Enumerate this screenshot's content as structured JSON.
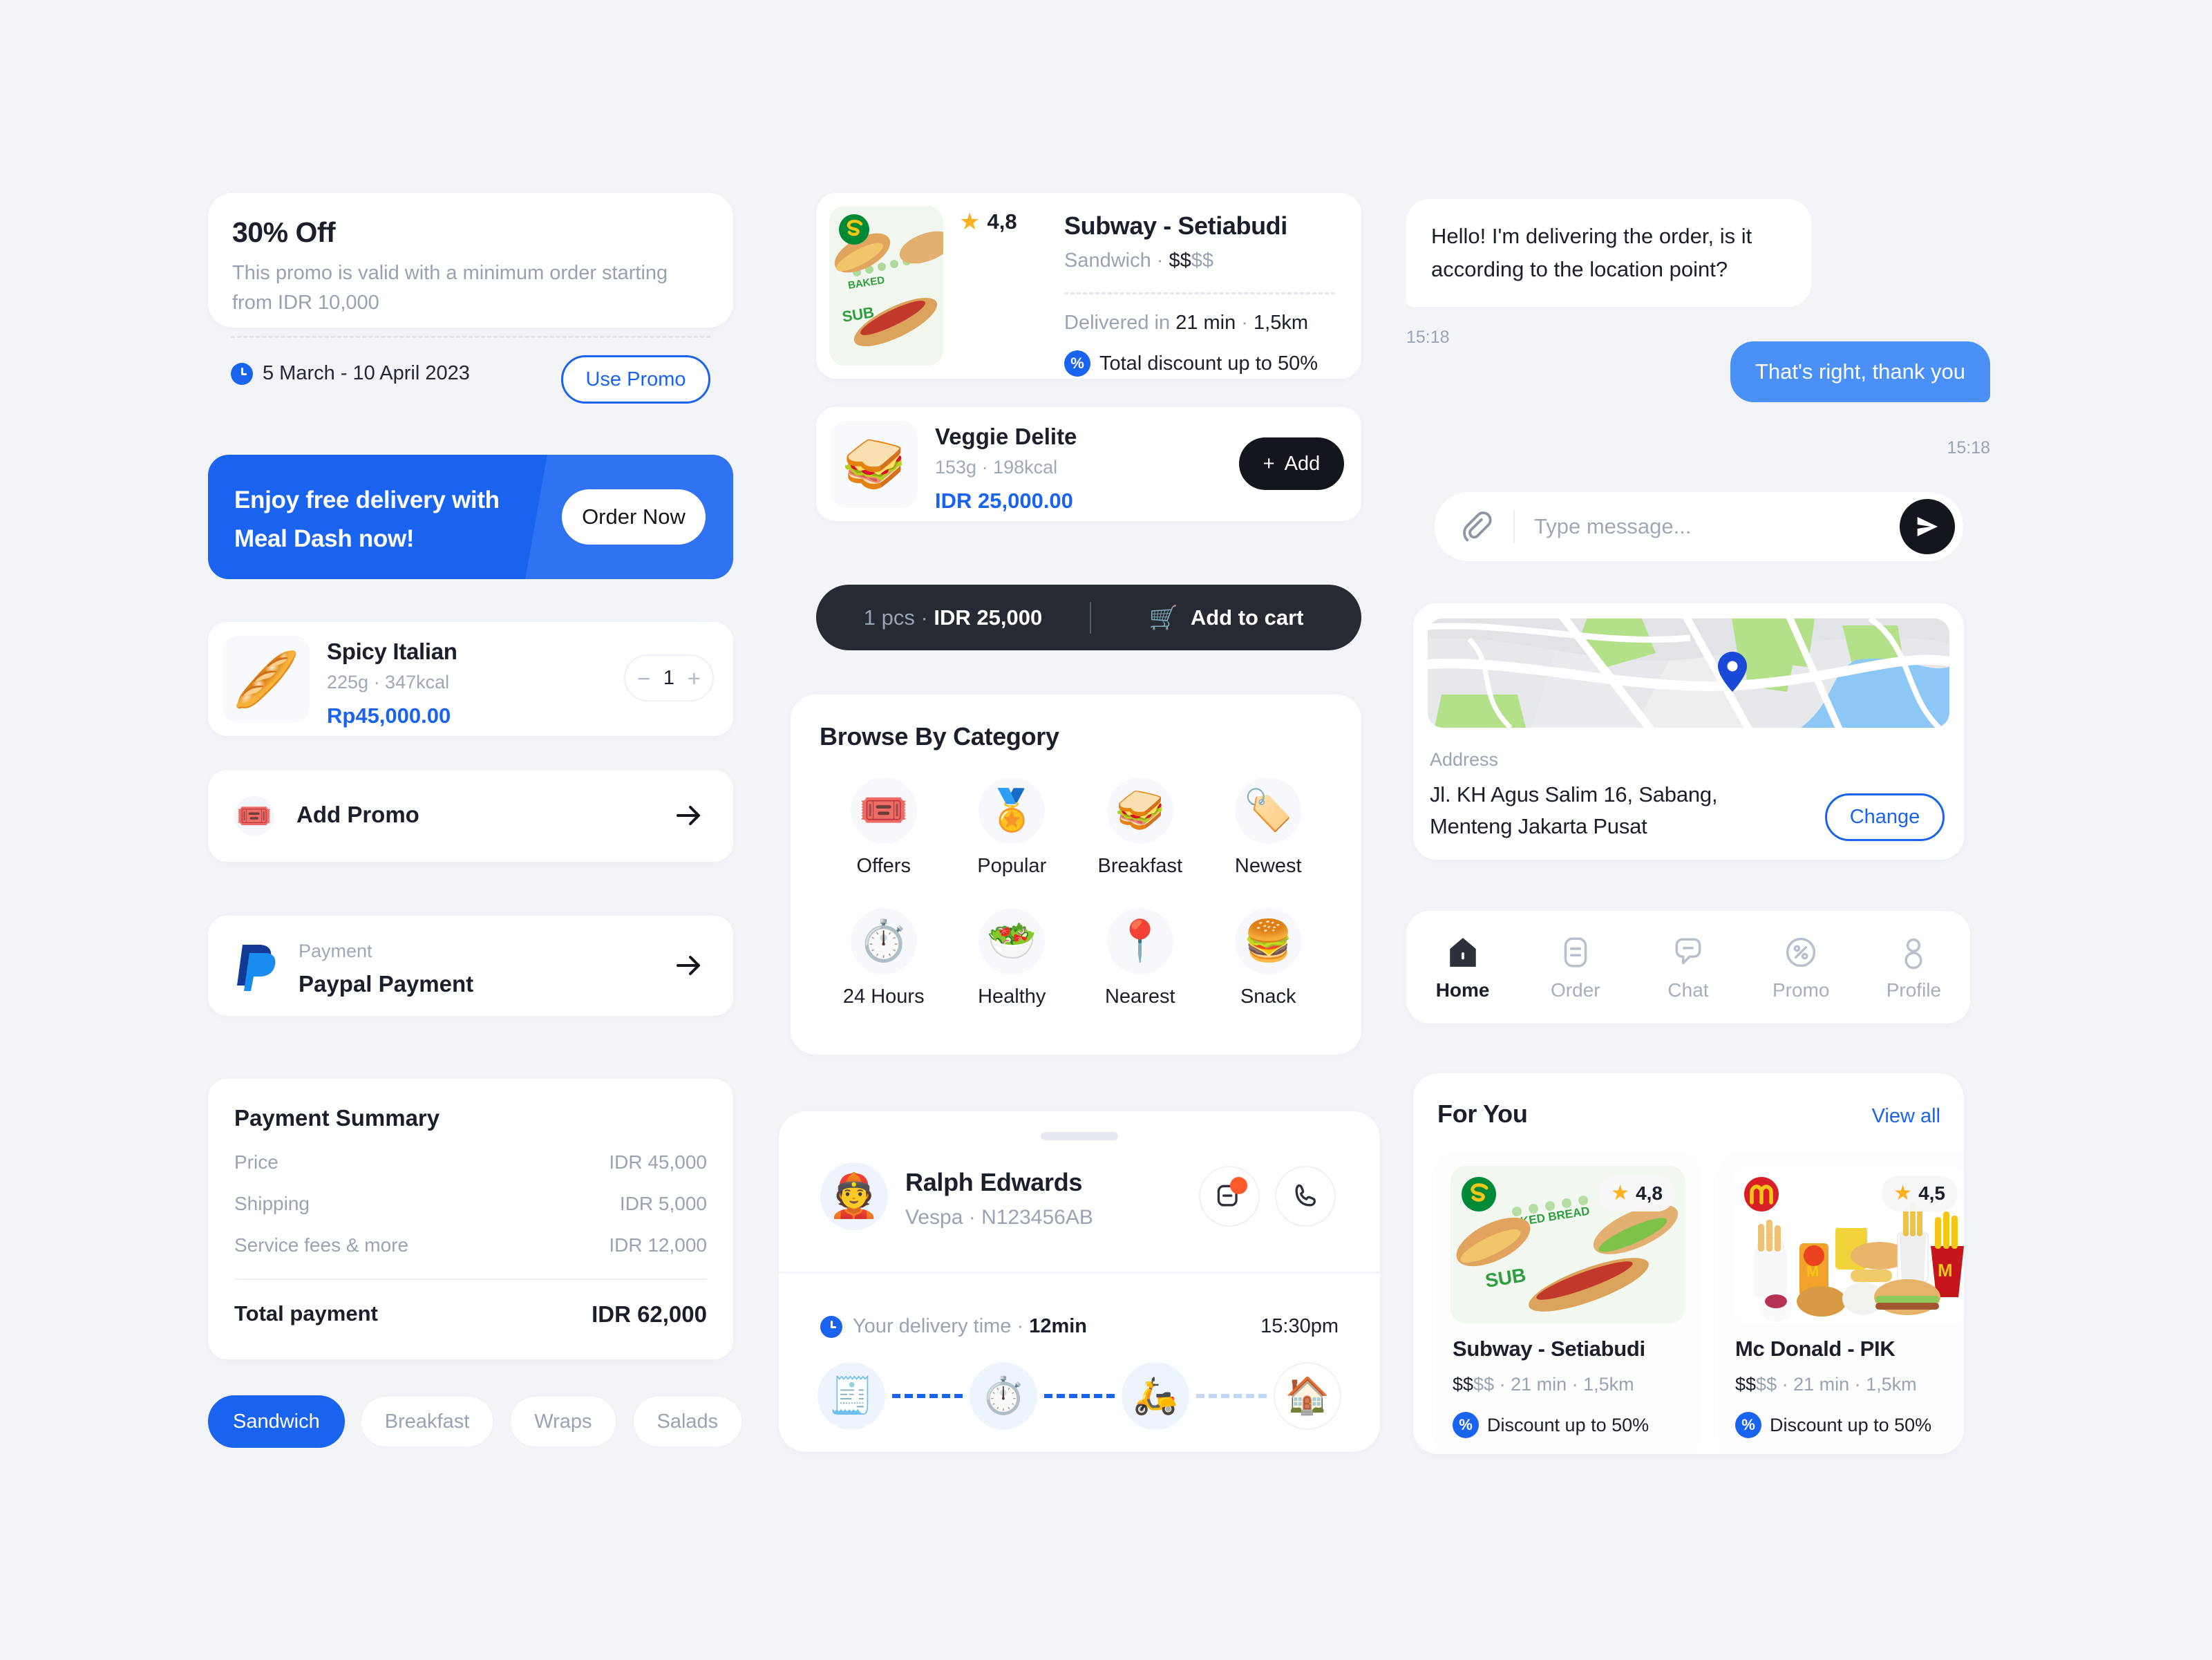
{
  "promo": {
    "title": "30% Off",
    "description": "This promo is valid with a minimum order starting from IDR 10,000",
    "date_range": "5 March - 10 April 2023",
    "cta": "Use Promo"
  },
  "banner": {
    "text": "Enjoy free delivery with Meal Dash now!",
    "cta": "Order Now"
  },
  "cart_item": {
    "name": "Spicy Italian",
    "meta": "225g · 347kcal",
    "price": "Rp45,000.00",
    "quantity": "1"
  },
  "add_promo": {
    "label": "Add Promo"
  },
  "payment_method": {
    "label": "Payment",
    "value": "Paypal Payment"
  },
  "payment_summary": {
    "title": "Payment Summary",
    "rows": [
      {
        "label": "Price",
        "value": "IDR 45,000"
      },
      {
        "label": "Shipping",
        "value": "IDR 5,000"
      },
      {
        "label": "Service fees & more",
        "value": "IDR 12,000"
      }
    ],
    "total_label": "Total payment",
    "total_value": "IDR 62,000"
  },
  "chips": [
    {
      "label": "Sandwich",
      "selected": true
    },
    {
      "label": "Breakfast",
      "selected": false
    },
    {
      "label": "Wraps",
      "selected": false
    },
    {
      "label": "Salads",
      "selected": false
    }
  ],
  "restaurant": {
    "name": "Subway - Setiabudi",
    "rating": "4,8",
    "category": "Sandwich",
    "price_level": "$$",
    "price_level_dim": "$$",
    "delivery_prefix": "Delivered in ",
    "delivery_time": "21 min",
    "delivery_sep": " · ",
    "delivery_distance": "1,5km",
    "discount": "Total discount up to 50%"
  },
  "menu_item": {
    "name": "Veggie Delite",
    "meta": "153g · 198kcal",
    "price": "IDR 25,000.00",
    "add_label": "Add"
  },
  "cart_bar": {
    "qty": "1 pcs",
    "separator": " · ",
    "amount": "IDR 25,000",
    "cta": "Add to cart"
  },
  "categories": {
    "title": "Browse By Category",
    "items": [
      {
        "label": "Offers",
        "icon": "ticket-percent-icon",
        "glyph": "🎟️"
      },
      {
        "label": "Popular",
        "icon": "badge-check-icon",
        "glyph": "🏅"
      },
      {
        "label": "Breakfast",
        "icon": "sandwich-icon",
        "glyph": "🥪"
      },
      {
        "label": "Newest",
        "icon": "menu-tag-icon",
        "glyph": "🏷️"
      },
      {
        "label": "24 Hours",
        "icon": "stopwatch-icon",
        "glyph": "⏱️"
      },
      {
        "label": "Healthy",
        "icon": "salad-icon",
        "glyph": "🥗"
      },
      {
        "label": "Nearest",
        "icon": "map-pin-food-icon",
        "glyph": "📍"
      },
      {
        "label": "Snack",
        "icon": "burger-icon",
        "glyph": "🍔"
      }
    ]
  },
  "driver": {
    "name": "Ralph Edwards",
    "vehicle": "Vespa · N123456AB",
    "delivery_label": "Your delivery time · ",
    "delivery_value": "12min",
    "eta": "15:30pm",
    "steps": [
      {
        "name": "order-placed",
        "glyph": "🧾"
      },
      {
        "name": "preparing",
        "glyph": "⏱️"
      },
      {
        "name": "on-the-way",
        "glyph": "🛵"
      },
      {
        "name": "delivered-home",
        "glyph": "🏠"
      }
    ]
  },
  "chat": {
    "incoming_text": "Hello! I'm delivering the order, is it according to the location point?",
    "incoming_time": "15:18",
    "outgoing_text": "That's right, thank you",
    "outgoing_time": "15:18",
    "input_placeholder": "Type message...",
    "input_value": ""
  },
  "address": {
    "label": "Address",
    "value": "Jl. KH Agus Salim 16, Sabang, Menteng Jakarta Pusat",
    "change_label": "Change"
  },
  "nav": {
    "items": [
      {
        "label": "Home",
        "icon": "home-icon",
        "active": true
      },
      {
        "label": "Order",
        "icon": "order-icon",
        "active": false
      },
      {
        "label": "Chat",
        "icon": "chat-icon",
        "active": false
      },
      {
        "label": "Promo",
        "icon": "percent-icon",
        "active": false
      },
      {
        "label": "Profile",
        "icon": "user-icon",
        "active": false
      }
    ]
  },
  "for_you": {
    "title": "For You",
    "view_all": "View all",
    "cards": [
      {
        "name": "Subway - Setiabudi",
        "rating": "4,8",
        "price_level": "$$",
        "price_level_dim": "$$",
        "meta_time": "21 min",
        "meta_distance": "1,5km",
        "discount": "Discount up to 50%"
      },
      {
        "name": "Mc Donald - PIK",
        "rating": "4,5",
        "price_level": "$$",
        "price_level_dim": "$$",
        "meta_time": "21 min",
        "meta_distance": "1,5km",
        "discount": "Discount up to 50%"
      }
    ]
  },
  "colors": {
    "accent": "#1a63ee",
    "chat_bubble": "#4a90f7",
    "dark": "#14161d",
    "background": "#f2f4f8",
    "muted": "#9aa3b4",
    "star": "#ffb01f",
    "notify": "#ff5a2c"
  }
}
